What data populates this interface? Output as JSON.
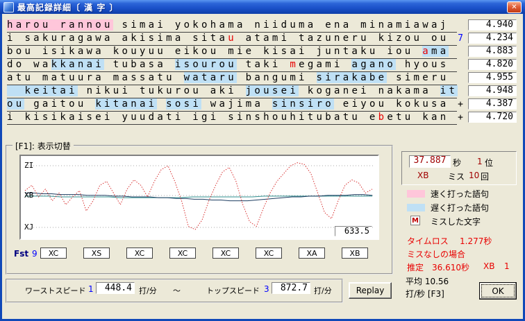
{
  "window": {
    "title": "最高記録詳細〔 漢 字 〕",
    "close": "✕"
  },
  "colors": {
    "highlight_fast": "#FFC6DA",
    "highlight_slow": "#BFE0F5",
    "miss_text": "#E80000",
    "record_number": "#A00000",
    "marker_blue": "#0000FF",
    "loss_red": "#E80000",
    "window_frame": "#1048B8"
  },
  "typing": {
    "lines": [
      {
        "segments": [
          {
            "t": "harou rannou",
            "s": "fast"
          },
          {
            "t": " simai yokohama niiduma ena minamiawaj",
            "s": "n"
          }
        ],
        "marker": "",
        "marker_class": "",
        "value": "4.940"
      },
      {
        "segments": [
          {
            "t": "i sakuragawa akisima sita",
            "s": "n"
          },
          {
            "t": "u",
            "s": "miss"
          },
          {
            "t": " atami tazuneru kizou ou",
            "s": "n"
          }
        ],
        "marker": "7",
        "marker_class": "mk-blue",
        "value": "4.234"
      },
      {
        "segments": [
          {
            "t": "bou isikawa kouyuu eikou mie kisai juntaku iou ",
            "s": "n"
          },
          {
            "t": "a",
            "s": "miss-slow"
          },
          {
            "t": "ma",
            "s": "slow"
          }
        ],
        "marker": "",
        "marker_class": "",
        "value": "4.883"
      },
      {
        "segments": [
          {
            "t": "do wa",
            "s": "n"
          },
          {
            "t": "kkanai",
            "s": "slow"
          },
          {
            "t": " tubasa ",
            "s": "n"
          },
          {
            "t": "isourou",
            "s": "slow"
          },
          {
            "t": " taki ",
            "s": "n"
          },
          {
            "t": "m",
            "s": "miss"
          },
          {
            "t": "egami ",
            "s": "n"
          },
          {
            "t": "agano",
            "s": "slow"
          },
          {
            "t": " hyous",
            "s": "n"
          }
        ],
        "marker": "",
        "marker_class": "",
        "value": "4.820"
      },
      {
        "segments": [
          {
            "t": "atu matuura massatu ",
            "s": "n"
          },
          {
            "t": "wataru",
            "s": "slow"
          },
          {
            "t": " bangumi ",
            "s": "n"
          },
          {
            "t": "sirakabe",
            "s": "slow"
          },
          {
            "t": " simeru",
            "s": "n"
          }
        ],
        "marker": "",
        "marker_class": "",
        "value": "4.955"
      },
      {
        "segments": [
          {
            "t": "  keitai",
            "s": "slow"
          },
          {
            "t": " nikui tukurou aki ",
            "s": "n"
          },
          {
            "t": "jousei",
            "s": "slow"
          },
          {
            "t": " koganei nakama ",
            "s": "n"
          },
          {
            "t": "it",
            "s": "slow"
          }
        ],
        "marker": "",
        "marker_class": "",
        "value": "4.948"
      },
      {
        "segments": [
          {
            "t": "ou",
            "s": "slow"
          },
          {
            "t": " gaitou ",
            "s": "n"
          },
          {
            "t": "kitanai",
            "s": "slow"
          },
          {
            "t": " ",
            "s": "n"
          },
          {
            "t": "sosi",
            "s": "slow"
          },
          {
            "t": " wajima ",
            "s": "n"
          },
          {
            "t": "sinsiro",
            "s": "slow"
          },
          {
            "t": " eiyou kokusa",
            "s": "n"
          }
        ],
        "marker": "+",
        "marker_class": "mk-black",
        "value": "4.387"
      },
      {
        "segments": [
          {
            "t": "i kisikaisei yuudati igi sinshouhitubatu e",
            "s": "n"
          },
          {
            "t": "b",
            "s": "miss"
          },
          {
            "t": "etu kan",
            "s": "n"
          }
        ],
        "marker": "+",
        "marker_class": "mk-black",
        "value": "4.720"
      }
    ]
  },
  "chart": {
    "groupbox_label": "[F1]: 表示切替",
    "y_top": "ZI",
    "y_mid": "XB",
    "y_bot": "XJ",
    "value_box": "633.5",
    "series": {
      "speed": [
        42,
        35,
        50,
        40,
        55,
        45,
        60,
        50,
        42,
        68,
        55,
        35,
        30,
        45,
        60,
        40,
        28,
        35,
        50,
        30,
        15,
        10,
        30,
        55,
        88,
        92,
        80,
        55,
        35,
        18,
        12,
        30,
        60,
        82,
        88,
        65,
        45,
        30,
        20,
        10,
        6,
        8,
        20,
        45,
        70,
        78,
        55,
        35,
        28,
        32,
        45,
        40
      ],
      "avg": [
        45,
        45,
        46,
        46,
        47,
        47,
        47,
        48,
        48,
        48,
        49,
        49,
        50,
        50,
        50,
        51,
        51,
        52,
        52,
        53,
        53,
        54,
        54,
        55,
        55,
        55,
        54,
        53,
        52,
        51,
        50,
        50,
        49,
        49,
        48,
        48,
        48,
        47,
        47,
        48
      ],
      "trend": [
        49,
        49,
        49,
        50,
        50,
        50,
        50,
        50,
        51,
        51,
        51,
        51,
        51,
        51,
        50,
        50,
        50,
        50,
        50,
        50,
        49,
        49,
        49,
        49,
        49,
        49,
        49,
        49,
        49,
        49
      ]
    }
  },
  "fst": {
    "label": "Fst",
    "count": "9",
    "boxes": [
      "XC",
      "XS",
      "XC",
      "XC",
      "XC",
      "XC",
      "XA",
      "XB"
    ]
  },
  "speed_bar": {
    "worst_label": "ワーストスピード",
    "worst_rank": "1",
    "worst_value": "448.4",
    "worst_unit": "打/分",
    "tilde": "～",
    "top_label": "トップスピード",
    "top_rank": "3",
    "top_value": "872.7",
    "top_unit": "打/分"
  },
  "buttons": {
    "replay": "Replay",
    "ok": "OK"
  },
  "stats": {
    "time": "37.887",
    "time_unit": "秒",
    "rank": "1",
    "rank_unit": "位",
    "grade": "XB",
    "miss_label": "ミス",
    "miss_count": "10",
    "miss_unit": "回"
  },
  "legend": {
    "fast_label": "速く打った語句",
    "slow_label": "遅く打った語句",
    "miss_icon": "M",
    "miss_label": "ミスした文字"
  },
  "loss": {
    "label": "タイムロス",
    "value": "1.277秒",
    "nomiss": "ミスなしの場合",
    "est_label": "推定",
    "est_value": "36.610秒",
    "est_grade": "XB",
    "est_rank": "1"
  },
  "average": {
    "line1": "平均 10.56",
    "line2": "打/秒 [F3]"
  }
}
